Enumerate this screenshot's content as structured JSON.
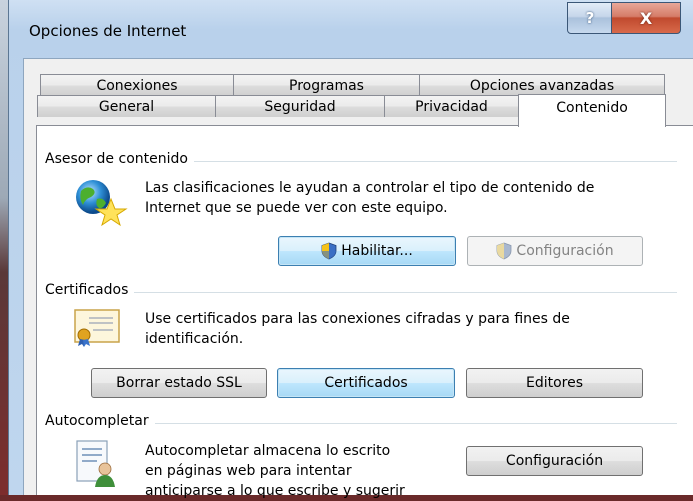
{
  "window": {
    "title": "Opciones de Internet",
    "help_label": "?",
    "close_label": "X"
  },
  "tabs": {
    "row1": [
      "Conexiones",
      "Programas",
      "Opciones avanzadas"
    ],
    "row2": [
      "General",
      "Seguridad",
      "Privacidad",
      "Contenido"
    ],
    "active": "Contenido"
  },
  "content_advisor": {
    "label": "Asesor de contenido",
    "description_line1": "Las clasificaciones le ayudan a controlar el tipo de contenido de",
    "description_line2": "Internet que se puede ver con este equipo.",
    "enable_button": "Habilitar...",
    "settings_button": "Configuración",
    "icon": "globe-star-icon"
  },
  "certificates": {
    "label": "Certificados",
    "description_line1": "Use certificados para las conexiones cifradas y para fines de",
    "description_line2": "identificación.",
    "clear_ssl_button": "Borrar estado SSL",
    "certificates_button": "Certificados",
    "publishers_button": "Editores",
    "icon": "certificate-icon"
  },
  "autocomplete": {
    "label": "Autocompletar",
    "description_line1": "Autocompletar almacena lo escrito",
    "description_line2": "en páginas web para intentar",
    "description_line3": "anticiparse a lo que escribe y sugerir",
    "settings_button": "Configuración",
    "icon": "autocomplete-user-icon"
  },
  "colors": {
    "accent": "#3c7fb1",
    "close": "#c04a2e"
  }
}
